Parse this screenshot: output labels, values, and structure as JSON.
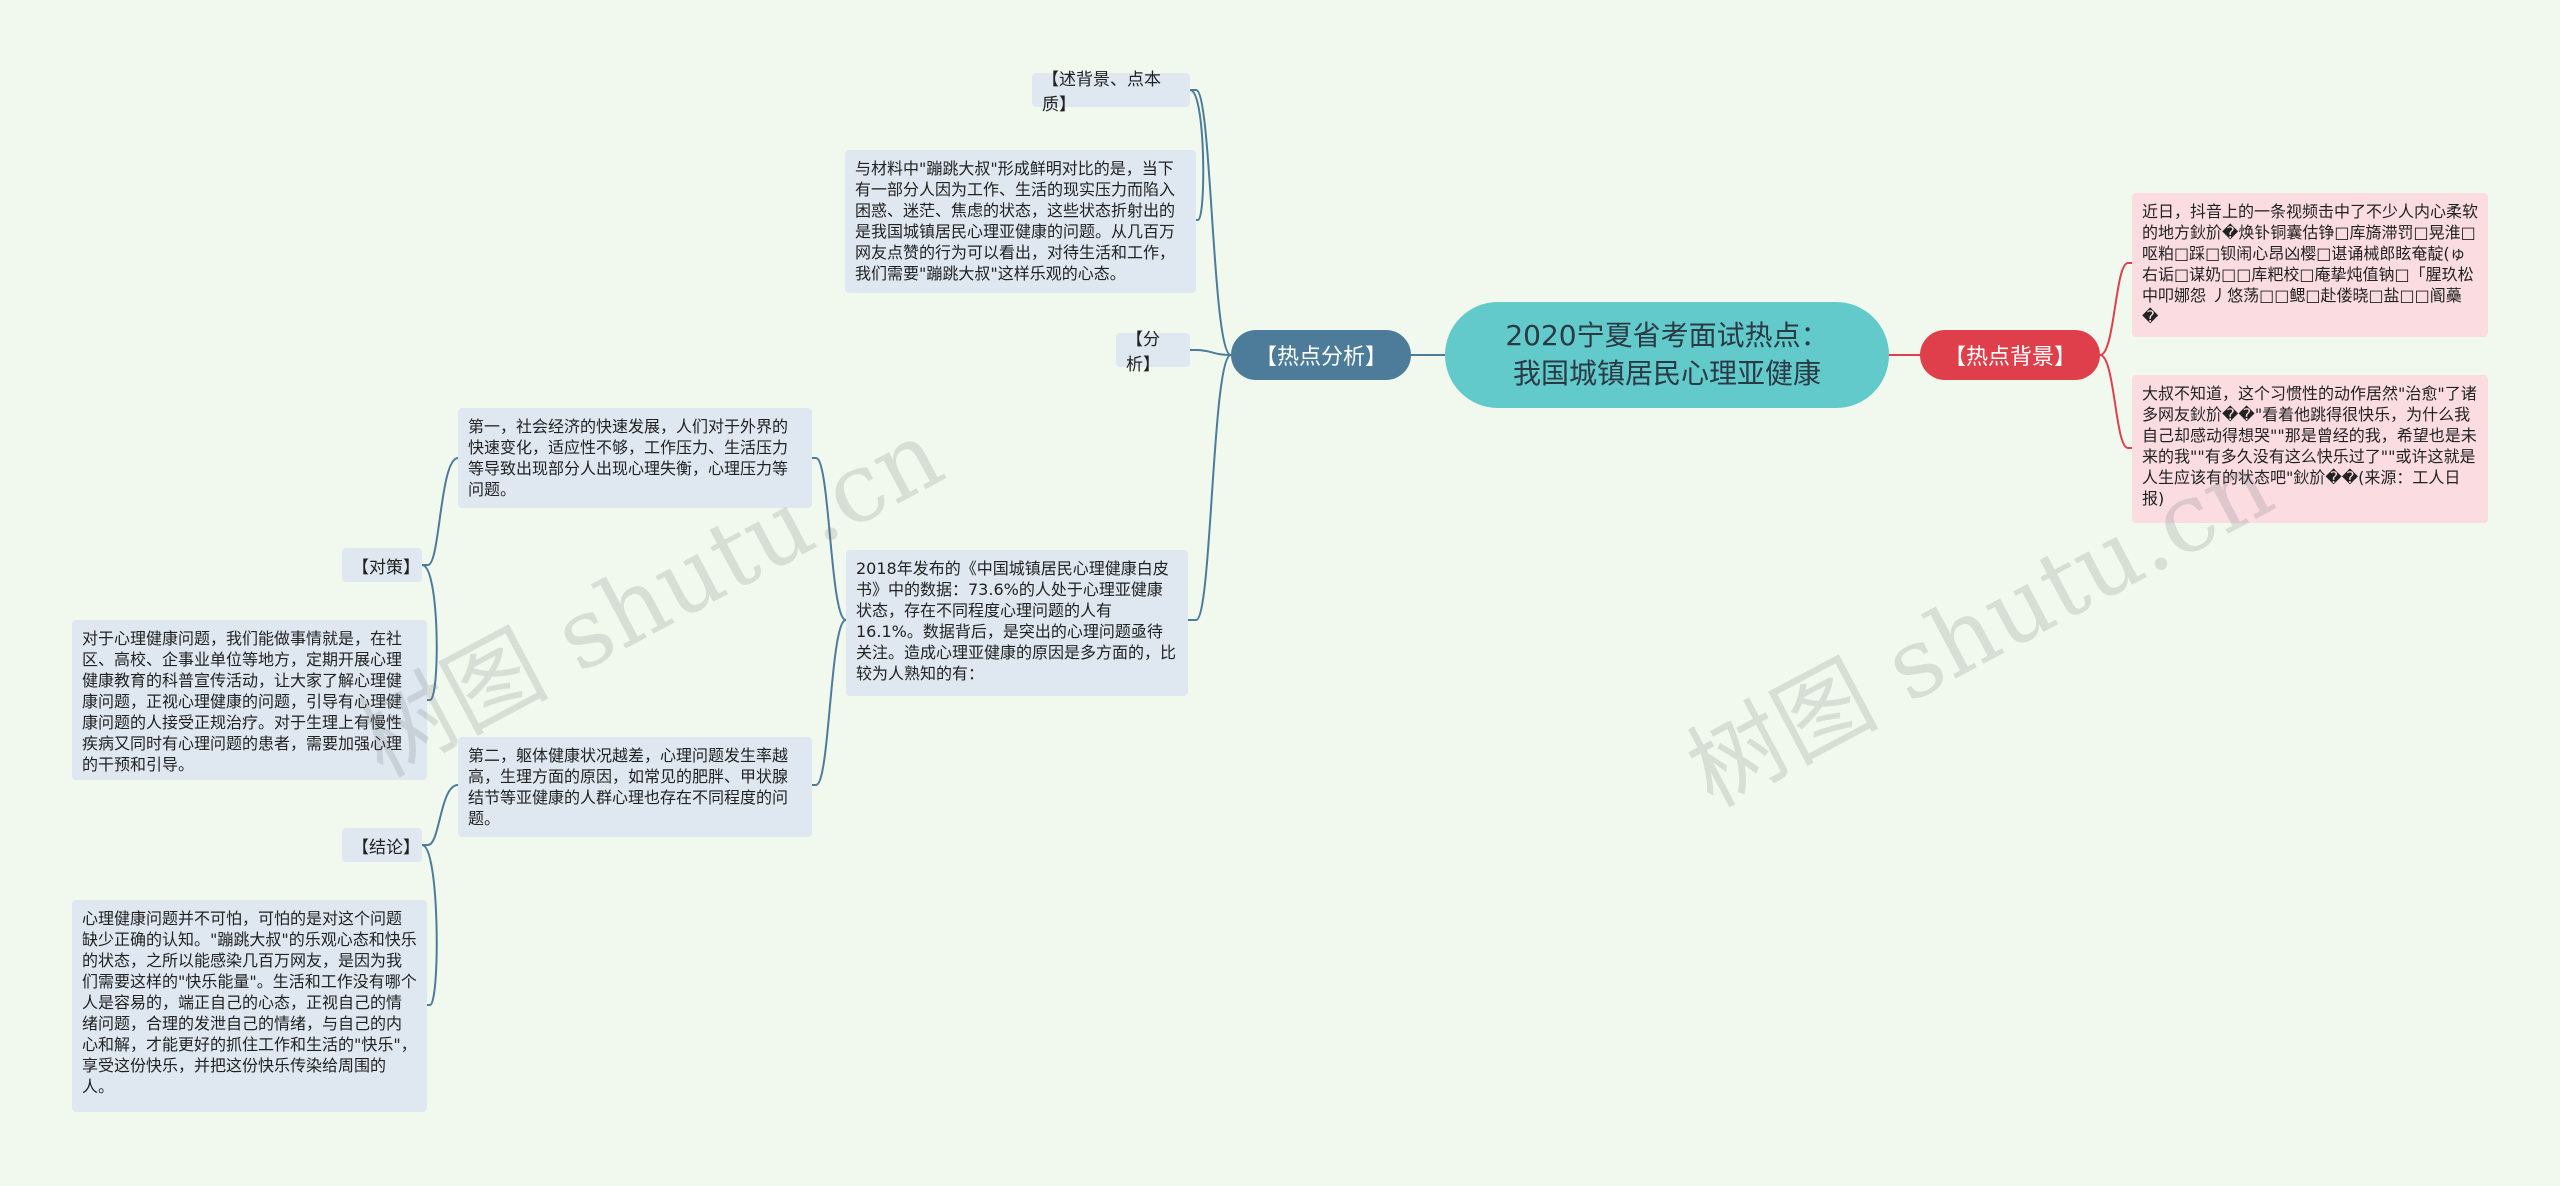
{
  "central": {
    "title_line1": "2020宁夏省考面试热点：",
    "title_line2": "我国城镇居民心理亚健康"
  },
  "left_branch": {
    "label": "【热点分析】",
    "tag_background": "【述背景、点本质】",
    "tag_analysis": "【分析】",
    "contrast_text": "与材料中\"蹦跳大叔\"形成鲜明对比的是，当下有一部分人因为工作、生活的现实压力而陷入困惑、迷茫、焦虑的状态，这些状态折射出的是我国城镇居民心理亚健康的问题。从几百万网友点赞的行为可以看出，对待生活和工作，我们需要\"蹦跳大叔\"这样乐观的心态。",
    "data_text": "2018年发布的《中国城镇居民心理健康白皮书》中的数据：73.6%的人处于心理亚健康状态，存在不同程度心理问题的人有16.1%。数据背后，是突出的心理问题亟待关注。造成心理亚健康的原因是多方面的，比较为人熟知的有：",
    "reason1_text": "第一，社会经济的快速发展，人们对于外界的快速变化，适应性不够，工作压力、生活压力等导致出现部分人出现心理失衡，心理压力等问题。",
    "reason2_text": "第二，躯体健康状况越差，心理问题发生率越高，生理方面的原因，如常见的肥胖、甲状腺结节等亚健康的人群心理也存在不同程度的问题。",
    "tag_countermeasure": "【对策】",
    "countermeasure_text": "对于心理健康问题，我们能做事情就是，在社区、高校、企事业单位等地方，定期开展心理健康教育的科普宣传活动，让大家了解心理健康问题，正视心理健康的问题，引导有心理健康问题的人接受正规治疗。对于生理上有慢性疾病又同时有心理问题的患者，需要加强心理的干预和引导。",
    "tag_conclusion": "【结论】",
    "conclusion_text": "心理健康问题并不可怕，可怕的是对这个问题缺少正确的认知。\"蹦跳大叔\"的乐观心态和快乐的状态，之所以能感染几百万网友，是因为我们需要这样的\"快乐能量\"。生活和工作没有哪个人是容易的，端正自己的心态，正视自己的情绪问题，合理的发泄自己的情绪，与自己的内心和解，才能更好的抓住工作和生活的\"快乐\"，享受这份快乐，并把这份快乐传染给周围的人。"
  },
  "right_branch": {
    "label": "【热点背景】",
    "text1": "近日，抖音上的一条视频击中了不少人内心柔软的地方鈥斺�焕钋铜囊估铮□库旖滞罚□晃淮□呕粕□踩□钡闹心昂凶樱□谌诵械郎眩奄靛(ゅ右诟□谋奶□□库粑校□庵挚炖值钠□「腥玖松中叩娜怨 丿悠荡□□鳃□赴偻晓□盐□□阍蘽�",
    "text2": "大叔不知道，这个习惯性的动作居然\"治愈\"了诸多网友鈥斺��\"看着他跳得很快乐，为什么我自己却感动得想哭\"\"那是曾经的我，希望也是未来的我\"\"有多久没有这么快乐过了\"\"或许这就是人生应该有的状态吧\"鈥斺��(来源：工人日报)"
  },
  "watermarks": [
    "树图 shutu.cn",
    "树图 shutu.cn"
  ],
  "colors": {
    "background": "#f1f9ee",
    "central": "#63cacb",
    "analysis": "#4d7b9a",
    "hot_background": "#df3f4b",
    "box": "#dfe8f1",
    "pink_box": "#fbdde1",
    "line_blue": "#4d7b9a",
    "line_red": "#df3f4b"
  }
}
